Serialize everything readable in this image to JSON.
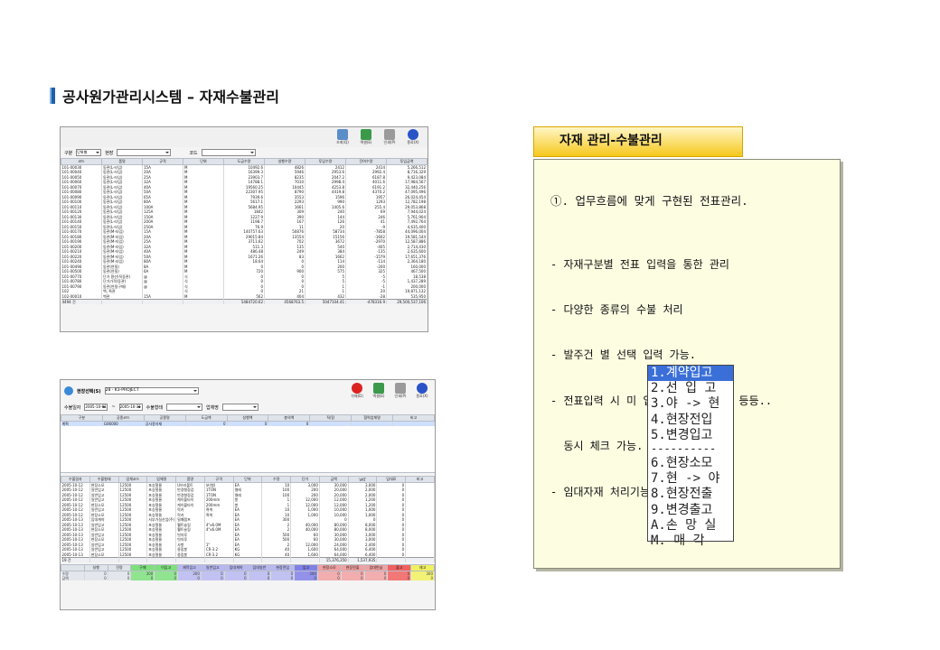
{
  "page": {
    "title": "공사원가관리시스템 – 자재수불관리"
  },
  "screenshot1": {
    "toolbar": [
      "조회(Q)",
      "엑셀(E)",
      "인쇄(P)",
      "종료(X)"
    ],
    "filters": {
      "label1": "구분",
      "value1": "단위별",
      "label2": "현장",
      "label3": "코드"
    },
    "headers": [
      "코드",
      "품명",
      "규격",
      "단위",
      "도급수량",
      "실행수량",
      "투입수량",
      "잔여수량",
      "투입금액"
    ],
    "rows": [
      [
        "101-00030",
        "동관(L-타입)",
        "15A",
        "M",
        "10492.6",
        "4826",
        "2412",
        "2414",
        "5,266,512"
      ],
      [
        "101-00040",
        "동관(L-타입)",
        "20A",
        "M",
        "16399.3",
        "5946",
        "2953.6",
        "2992.4",
        "8,716,329"
      ],
      [
        "101-00050",
        "동관(L-타입)",
        "25A",
        "M",
        "23903.7",
        "8235",
        "2047.2",
        "6187.8",
        "9,423,084"
      ],
      [
        "101-00060",
        "동관(L-타입)",
        "32A",
        "M",
        "14788.1",
        "7010",
        "2998.4",
        "4011.6",
        "17,984,567"
      ],
      [
        "101-00070",
        "동관(L-타입)",
        "40A",
        "M",
        "19560.25",
        "10445",
        "4253.8",
        "6191.2",
        "32,440,256"
      ],
      [
        "101-00080",
        "동관(L-타입)",
        "50A",
        "M",
        "22307.95",
        "8790",
        "4419.8",
        "4370.2",
        "47,095,496"
      ],
      [
        "101-00090",
        "동관(L-타입)",
        "65A",
        "M",
        "7939.6",
        "3553",
        "1596",
        "1957",
        "26,024,454"
      ],
      [
        "101-00100",
        "동관(L-타입)",
        "80A",
        "M",
        "5617.1",
        "2293",
        "990",
        "1293",
        "12,782,198"
      ],
      [
        "101-00110",
        "동관(L-타입)",
        "100A",
        "M",
        "5684.95",
        "1661",
        "1405.6",
        "255.4",
        "29,053,868"
      ],
      [
        "101-00120",
        "동관(L-타입)",
        "125A",
        "M",
        "1842",
        "309",
        "240",
        "69",
        "7,944,024"
      ],
      [
        "101-00130",
        "동관(L-타입)",
        "150A",
        "M",
        "1227.9",
        "390",
        "144",
        "246",
        "5,761,904"
      ],
      [
        "101-00140",
        "동관(L-타입)",
        "200A",
        "M",
        "1198.7",
        "167",
        "126",
        "41",
        "7,492,764"
      ],
      [
        "101-00150",
        "동관(L-타입)",
        "250A",
        "M",
        "76.9",
        "11",
        "20",
        "-9",
        "4,635,400"
      ],
      [
        "101-00170",
        "동관(M-타입)",
        "15A",
        "M",
        "140757.63",
        "50876",
        "58734",
        "-7858",
        "44,096,004"
      ],
      [
        "101-00180",
        "동관(M-타입)",
        "20A",
        "M",
        "29015.84",
        "13554",
        "15156",
        "-1602",
        "19,581,544"
      ],
      [
        "101-00190",
        "동관(M-타입)",
        "25A",
        "M",
        "3711.62",
        "702",
        "3672",
        "-2970",
        "12,587,886"
      ],
      [
        "101-00200",
        "동관(M-타입)",
        "32A",
        "M",
        "511.3",
        "135",
        "540",
        "-405",
        "2,714,430"
      ],
      [
        "101-00210",
        "동관(M-타입)",
        "40A",
        "M",
        "486.48",
        "249",
        "384",
        "-135",
        "2,635,600"
      ],
      [
        "101-00220",
        "동관(M-타입)",
        "50A",
        "M",
        "1671.26",
        "83",
        "1662",
        "-1579",
        "17,651,376"
      ],
      [
        "101-00240",
        "동관(M-타입)",
        "80A",
        "M",
        "18.64",
        "0",
        "114",
        "-114",
        "2,364,180"
      ],
      [
        "101-00490",
        "동관(연질)",
        "8A",
        "M",
        "0",
        "0",
        "200",
        "-200",
        "160,000"
      ],
      [
        "101-00500",
        "동관(연질)",
        "6A",
        "M",
        "720",
        "900",
        "575",
        "325",
        "467,500"
      ],
      [
        "101-00770",
        "단가 환산(직동관)",
        "@",
        "식",
        "0",
        "0",
        "5",
        "-5",
        "18,538"
      ],
      [
        "101-00780",
        "단가가격(동관)",
        "@",
        "식",
        "0",
        "0",
        "5",
        "-5",
        "1,437,289"
      ],
      [
        "101-00790",
        "동관(연질구매)",
        "@",
        "식",
        "0",
        "0",
        "1",
        "-1",
        "200,000"
      ],
      [
        "102",
        "백, 특관",
        "",
        "식",
        "0",
        "21",
        "1",
        "20",
        "19,871,132"
      ],
      [
        "102-00010",
        "백관",
        "15A",
        "M",
        "562",
        "404",
        "432",
        "-28",
        "535,950"
      ]
    ],
    "footer": [
      "4494 건",
      "",
      "",
      "",
      "5484720.62",
      "4568763.5",
      "5047104.41",
      "-478316.9",
      "29,500,537,106"
    ]
  },
  "screenshot2": {
    "site_label": "현장선택(S)",
    "site_value": "28 - K3-PROJECT",
    "date_label": "수불일자",
    "date_from": "2005-10-01",
    "date_to": "2005-10-31",
    "type_label": "수불형태",
    "work_label": "업체명",
    "toolbar": [
      "삭제(D)",
      "엑셀(E)",
      "인쇄(P)",
      "종료(X)"
    ],
    "top_headers": [
      "구분",
      "공종코드",
      "공종명",
      "도급액",
      "실행액",
      "총의액",
      "직/장",
      "협력업체명",
      "비고"
    ],
    "top_rows": [
      [
        "계획",
        "G06000",
        "공사용자재",
        "0",
        "0",
        "0",
        "",
        "",
        ""
      ]
    ],
    "bottom_headers": [
      "수불일자",
      "수불형태",
      "업체코드",
      "업체명",
      "품명",
      "규격",
      "단위",
      "수량",
      "단가",
      "금액",
      "VAT",
      "임대료",
      "비고"
    ],
    "bottom_rows": [
      [
        "2005-10-12",
        "현장소모",
        "12500",
        "포승철물",
        "U브라볼트",
        "보(형)",
        "EA",
        "10",
        "3,000",
        "30,000",
        "3,000",
        "0",
        ""
      ],
      [
        "2005-10-12",
        "일반입고",
        "12500",
        "포승철물",
        "반경형장갑",
        "1TON",
        "켤레",
        "100",
        "200",
        "20,000",
        "2,000",
        "0",
        ""
      ],
      [
        "2005-10-12",
        "일반입고",
        "12500",
        "포승철물",
        "반경형장갑",
        "1TON",
        "켤레",
        "100",
        "200",
        "20,000",
        "2,000",
        "0",
        ""
      ],
      [
        "2005-10-12",
        "일반입고",
        "12500",
        "포승철물",
        "케이블타이",
        "200mm",
        "봉",
        "1",
        "12,000",
        "12,000",
        "1,200",
        "0",
        ""
      ],
      [
        "2005-10-12",
        "현장소모",
        "12500",
        "포승철물",
        "케이블타이",
        "200mm",
        "봉",
        "1",
        "12,000",
        "12,000",
        "1,200",
        "0",
        ""
      ],
      [
        "2005-10-12",
        "일반입고",
        "12500",
        "포승철물",
        "락카",
        "흑색",
        "EA",
        "10",
        "1,000",
        "10,000",
        "1,000",
        "0",
        ""
      ],
      [
        "2005-10-12",
        "현장소모",
        "12500",
        "포승철물",
        "락카",
        "흑색",
        "EA",
        "10",
        "1,000",
        "10,000",
        "1,000",
        "0",
        ""
      ],
      [
        "2005-10-13",
        "임대계약",
        "12500",
        "서부가실산업(주)",
        "밀폐펌프",
        "",
        "EA",
        "300",
        "",
        "0",
        "0",
        "0",
        ""
      ],
      [
        "2005-10-13",
        "일반입고",
        "12500",
        "포승철물",
        "웰트슬링",
        "4\"x6.0M",
        "EA",
        "2",
        "40,000",
        "80,000",
        "8,000",
        "0",
        ""
      ],
      [
        "2005-10-13",
        "현장소모",
        "12500",
        "포승철물",
        "웰트슬링",
        "4\"x6.0M",
        "EA",
        "2",
        "40,000",
        "80,000",
        "8,000",
        "0",
        ""
      ],
      [
        "2005-10-13",
        "일반입고",
        "12500",
        "포승철물",
        "빗자루",
        "",
        "EA",
        "500",
        "60",
        "30,000",
        "3,000",
        "0",
        ""
      ],
      [
        "2005-10-13",
        "현장소모",
        "12500",
        "포승철물",
        "빗자루",
        "",
        "EA",
        "500",
        "60",
        "30,000",
        "3,000",
        "0",
        ""
      ],
      [
        "2005-10-13",
        "일반입고",
        "12500",
        "포승철물",
        "사봉",
        "1\"",
        "EA",
        "2",
        "12,000",
        "24,000",
        "2,400",
        "0",
        ""
      ],
      [
        "2005-10-13",
        "일반입고",
        "12500",
        "포승철물",
        "용접봉",
        "CR-3.2",
        "KG",
        "40",
        "1,600",
        "64,000",
        "6,400",
        "0",
        ""
      ],
      [
        "2005-10-13",
        "현장소모",
        "12500",
        "포승철물",
        "용접봉",
        "CR-3.2",
        "KG",
        "40",
        "1,600",
        "64,000",
        "6,400",
        "0",
        ""
      ]
    ],
    "bottom_footer": [
      "19 건",
      "",
      "",
      "",
      "",
      "",
      "",
      "",
      "",
      "15,376,350",
      "1,537,935",
      "",
      ""
    ],
    "summary_headers": [
      "",
      "실행",
      "잔량",
      "구매",
      "이입고",
      "재막입고",
      "일반입고",
      "임대계약",
      "임대일반",
      "현장전입",
      "입고",
      "현장소모",
      "현장전출",
      "임대반납",
      "출고",
      "재고"
    ],
    "summary_row1": [
      "수량",
      "0",
      "0",
      "300",
      "0",
      "300",
      "0",
      "0",
      "0",
      "0",
      "300",
      "0",
      "0",
      "0",
      "0",
      "300"
    ],
    "summary_row2": [
      "금액",
      "0",
      "0",
      "0",
      "0",
      "0",
      "0",
      "0",
      "0",
      "0",
      "0",
      "0",
      "0",
      "0",
      "0",
      "0"
    ]
  },
  "callout": {
    "tab_label": "자재 관리-수불관리",
    "heading": "①. 업무흐름에 맞게 구현된 전표관리.",
    "lines": [
      "- 자재구분별 전표 입력을 통한 관리",
      "- 다양한 종류의 수불 처리",
      "- 발주건 별 선택 입력 가능.",
      "- 전표입력 시 미 입고현황 및  재고 등등..",
      "  동시 체크 가능.",
      "- 임대자재 처리기능."
    ],
    "menu_items_top": [
      "1.계약입고",
      "2.선 입 고",
      "3.야 -> 현",
      "4.현장전입",
      "5.변경입고"
    ],
    "menu_separator": "----------",
    "menu_items_bottom": [
      "6.현장소모",
      "7.현 -> 야",
      "8.현장전출",
      "9.변경출고",
      "A.손 망 실",
      "M. 매   각"
    ]
  },
  "colors": {
    "accent_blue": "#1f5fa8",
    "tab_yellow": "#f6c81c",
    "callout_bg": "#fdfde2",
    "menu_highlight": "#3a6fd8"
  }
}
